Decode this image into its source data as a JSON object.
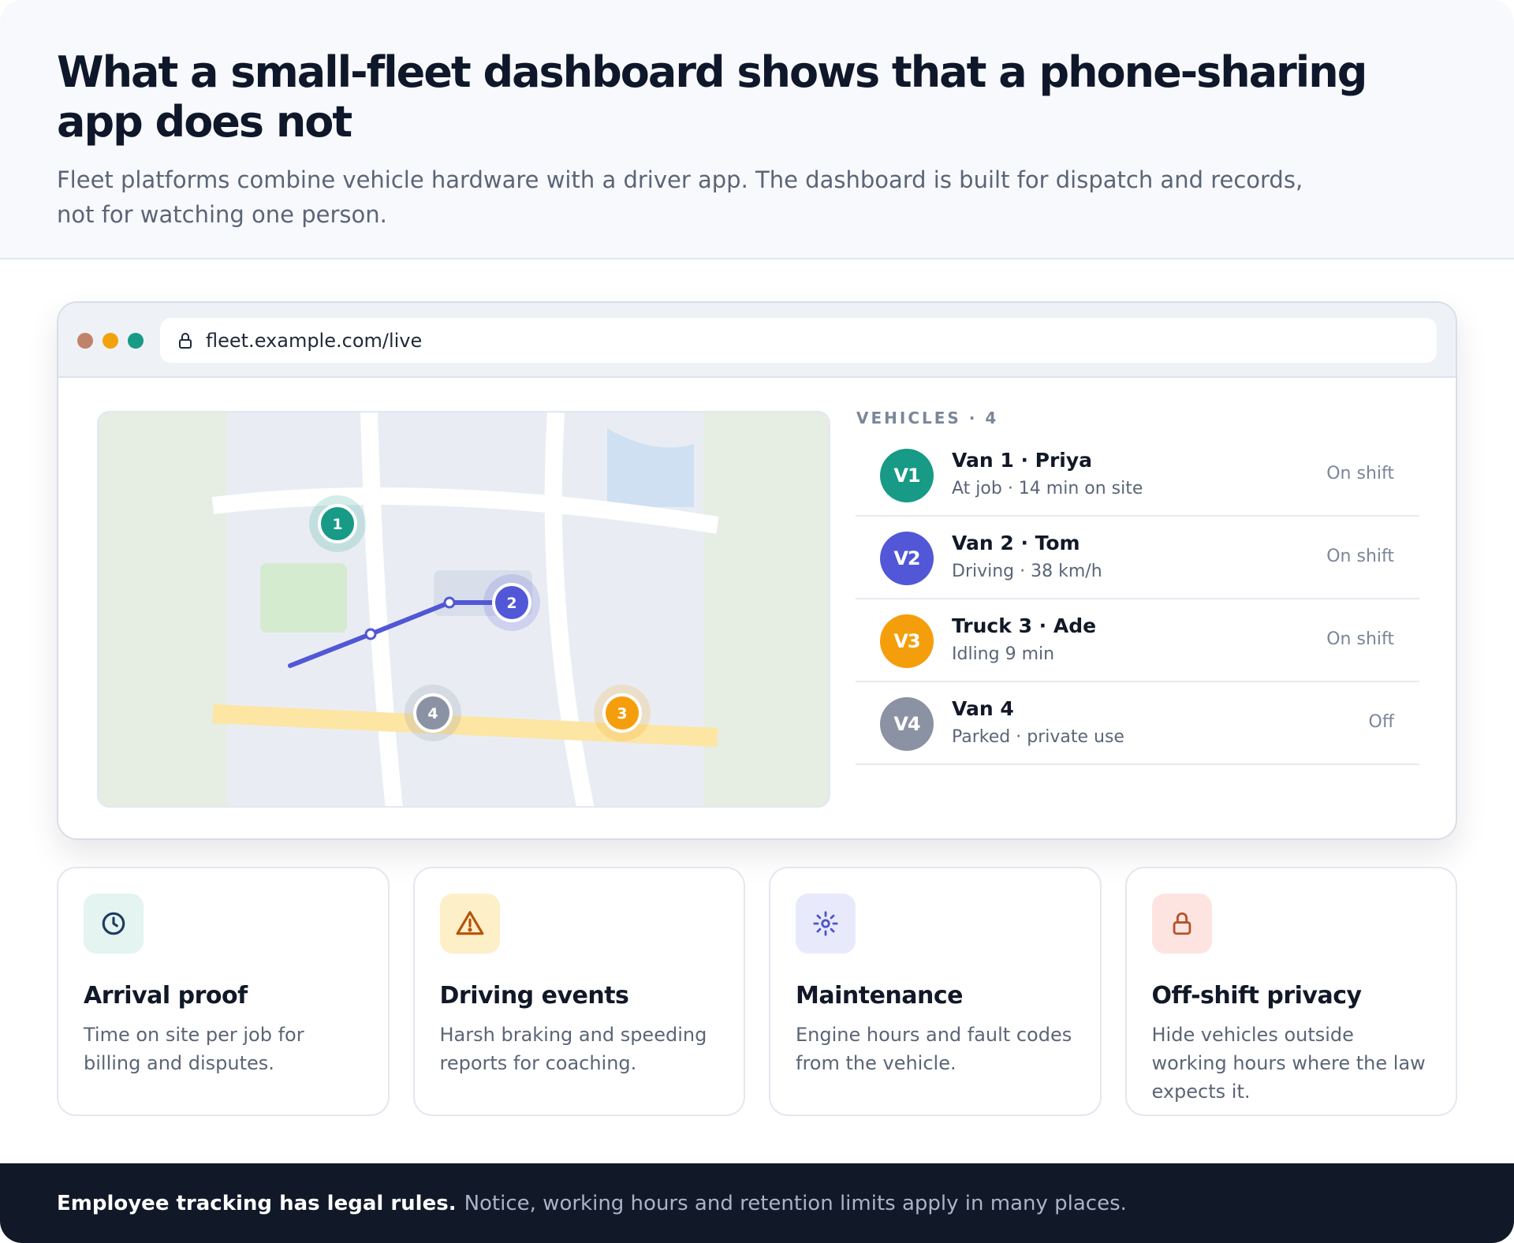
{
  "header": {
    "title": "What a small-fleet dashboard shows that a phone-sharing app does not",
    "subtitle": "Fleet platforms combine vehicle hardware with a driver app. The dashboard is built for dispatch and records, not for watching one person."
  },
  "browser": {
    "url": "fleet.example.com/live",
    "icons": [
      "lock-icon"
    ],
    "window_dot_colors": [
      "#c0836a",
      "#f2a20c",
      "#179a86"
    ]
  },
  "map": {
    "markers": [
      {
        "label": "1",
        "color": "#179a86"
      },
      {
        "label": "2",
        "color": "#5157d6"
      },
      {
        "label": "3",
        "color": "#f59e0b"
      },
      {
        "label": "4",
        "color": "#8a92a3"
      }
    ]
  },
  "vehicles": {
    "heading": "VEHICLES · 4",
    "items": [
      {
        "avatar": "V1",
        "name": "Van 1 · Priya",
        "detail": "At job · 14 min on site",
        "status": "On shift",
        "color": "#179a86"
      },
      {
        "avatar": "V2",
        "name": "Van 2 · Tom",
        "detail": "Driving · 38 km/h",
        "status": "On shift",
        "color": "#5157d6"
      },
      {
        "avatar": "V3",
        "name": "Truck 3 · Ade",
        "detail": "Idling 9 min",
        "status": "On shift",
        "color": "#f59e0b"
      },
      {
        "avatar": "V4",
        "name": "Van 4",
        "detail": "Parked · private use",
        "status": "Off",
        "color": "#8a92a3"
      }
    ]
  },
  "cards": [
    {
      "icon": "clock-icon",
      "title": "Arrival proof",
      "text": "Time on site per job for billing and disputes.",
      "icon_bg": "#e3f4f1",
      "icon_color": "#1e3a5f"
    },
    {
      "icon": "warning-icon",
      "title": "Driving events",
      "text": "Harsh braking and speeding reports for coaching.",
      "icon_bg": "#fdefc8",
      "icon_color": "#b45309"
    },
    {
      "icon": "gear-icon",
      "title": "Maintenance",
      "text": "Engine hours and fault codes from the vehicle.",
      "icon_bg": "#e8eafc",
      "icon_color": "#4f55c9"
    },
    {
      "icon": "lock-icon",
      "title": "Off-shift privacy",
      "text": "Hide vehicles outside working hours where the law expects it.",
      "icon_bg": "#fde4e1",
      "icon_color": "#b4532a"
    }
  ],
  "footer": {
    "strong": "Employee tracking has legal rules.",
    "rest": "Notice, working hours and retention limits apply in many places."
  }
}
